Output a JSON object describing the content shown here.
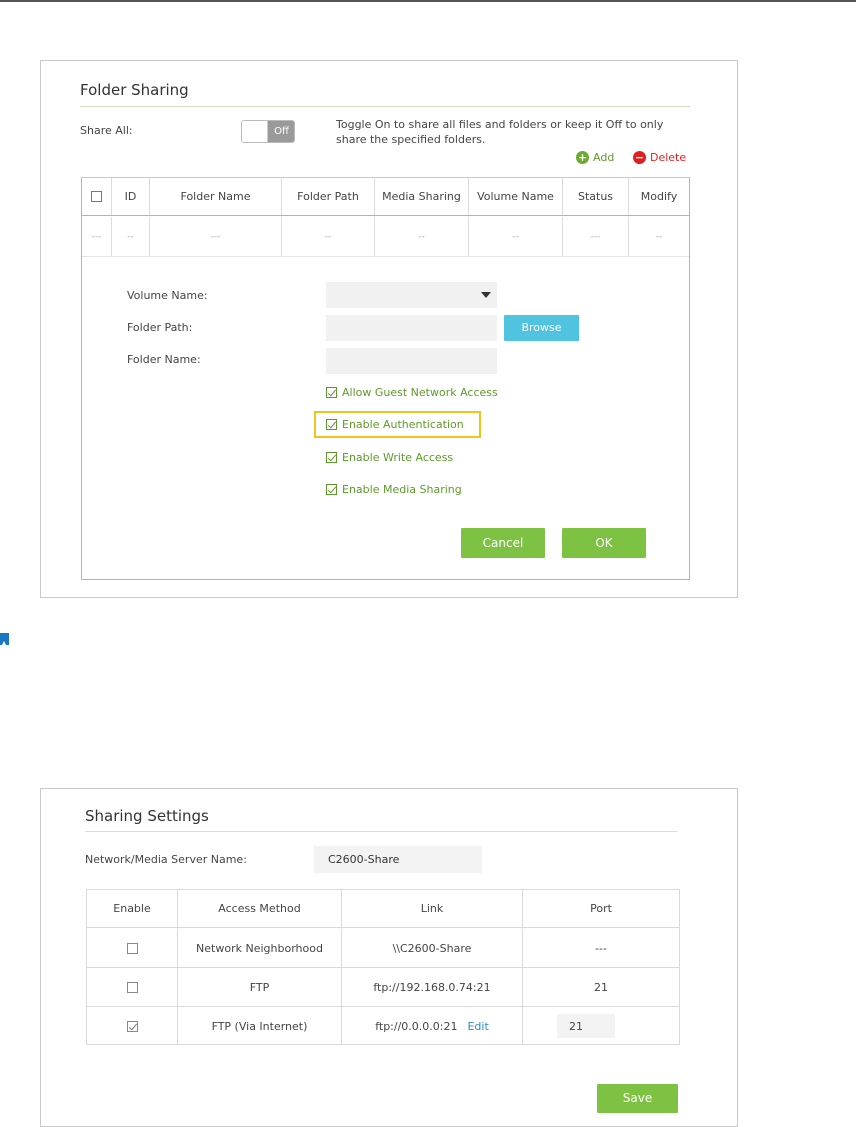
{
  "folder_sharing": {
    "title": "Folder Sharing",
    "share_all_label": "Share All:",
    "toggle_state": "Off",
    "description": "Toggle On to share all files and folders or keep it Off to only share the specified folders.",
    "add_label": "Add",
    "delete_label": "Delete",
    "columns": [
      "ID",
      "Folder Name",
      "Folder Path",
      "Media Sharing",
      "Volume Name",
      "Status",
      "Modify"
    ],
    "empty_row": [
      "---",
      "--",
      "---",
      "--",
      "--",
      "--",
      "---",
      "--"
    ],
    "form": {
      "volume_name_label": "Volume Name:",
      "folder_path_label": "Folder Path:",
      "folder_name_label": "Folder Name:",
      "browse_label": "Browse",
      "options": [
        {
          "label": "Allow Guest Network Access",
          "checked": true
        },
        {
          "label": "Enable Authentication",
          "checked": true
        },
        {
          "label": "Enable Write Access",
          "checked": true
        },
        {
          "label": "Enable Media Sharing",
          "checked": true
        }
      ],
      "cancel_label": "Cancel",
      "ok_label": "OK"
    }
  },
  "sharing_settings": {
    "title": "Sharing Settings",
    "server_name_label": "Network/Media Server Name:",
    "server_name_value": "C2600-Share",
    "columns": [
      "Enable",
      "Access Method",
      "Link",
      "Port"
    ],
    "rows": [
      {
        "enabled": false,
        "method": "Network Neighborhood",
        "link": "\\\\C2600-Share",
        "edit": "",
        "port": "---"
      },
      {
        "enabled": false,
        "method": "FTP",
        "link": "ftp://192.168.0.74:21",
        "edit": "",
        "port": "21"
      },
      {
        "enabled": true,
        "method": "FTP (Via Internet)",
        "link": "ftp://0.0.0.0:21",
        "edit": "Edit",
        "port": "21"
      }
    ],
    "save_label": "Save"
  },
  "colors": {
    "accent_green": "#7dc242",
    "browse_blue": "#4fc3e0",
    "delete_red": "#e02020",
    "highlight_yellow": "#f0c419"
  }
}
